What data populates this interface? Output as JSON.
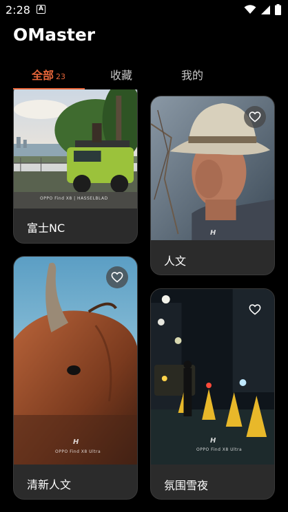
{
  "status_bar": {
    "time": "2:28",
    "notification_icon": "A"
  },
  "app": {
    "title": "OMaster"
  },
  "tabs": [
    {
      "label": "全部",
      "count": "23",
      "active": true
    },
    {
      "label": "收藏",
      "active": false
    },
    {
      "label": "我的",
      "active": false
    }
  ],
  "cards": [
    {
      "name": "富士NC",
      "watermark": "OPPO Find X8 | HASSELBLAD",
      "favorite_icon": "heart-outline-icon"
    },
    {
      "name": "人文",
      "watermark": "H",
      "favorite_icon": "heart-outline-icon"
    },
    {
      "name": "清新人文",
      "watermark": "OPPO Find X8 Ultra",
      "favorite_icon": "heart-outline-icon"
    },
    {
      "name": "氛围雪夜",
      "watermark": "OPPO Find X8 Ultra",
      "favorite_icon": "heart-outline-icon"
    }
  ],
  "colors": {
    "accent": "#e8663a",
    "background": "#000000",
    "card": "#2b2b2b"
  }
}
